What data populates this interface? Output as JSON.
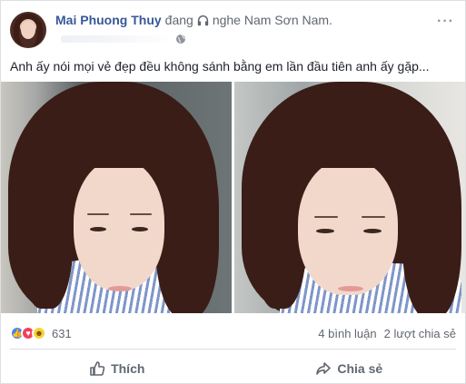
{
  "post": {
    "author": "Mai Phuong Thuy",
    "activity": "đang",
    "activity_icon": "headphones-icon",
    "activity_target": "nghe Nam Sơn Nam.",
    "privacy_icon": "globe-icon",
    "more_icon": "more-options-icon",
    "more_label": "···",
    "caption": "Anh ấy nói mọi vẻ đẹp đều không sánh bằng em lần đầu tiên anh ấy gặp..."
  },
  "reactions": {
    "icons": [
      "like-icon",
      "love-icon",
      "haha-icon"
    ],
    "count": "631",
    "comments": "4 bình luận",
    "shares": "2 lượt chia sẻ"
  },
  "actions": {
    "like_label": "Thích",
    "share_label": "Chia sẻ"
  },
  "colors": {
    "author_link": "#365899",
    "like_reaction": "#4a80f5",
    "love_reaction": "#f2415a",
    "haha_reaction": "#f7d13b"
  }
}
